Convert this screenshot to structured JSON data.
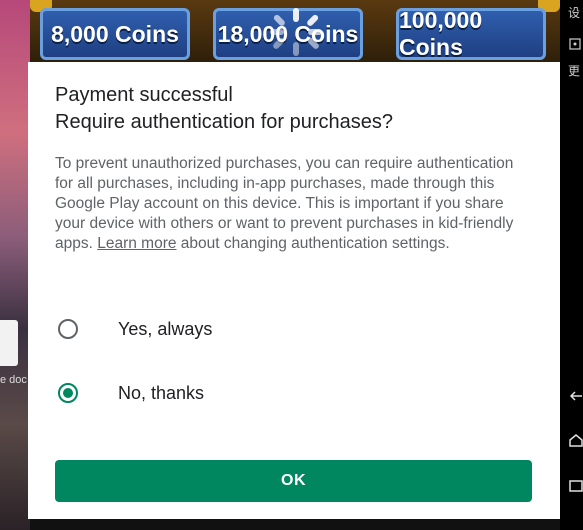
{
  "background": {
    "coin_packs": [
      {
        "label": "8,000 Coins"
      },
      {
        "label": "18,000 Coins"
      },
      {
        "label": "100,000 Coins"
      }
    ],
    "left_thumb_text": "e doc",
    "side_glyphs": [
      "设",
      "更"
    ]
  },
  "dialog": {
    "title_line1": "Payment successful",
    "title_line2": "Require authentication for purchases?",
    "body_before_link": "To prevent unauthorized purchases, you can require authentication for all purchases, including in-app purchases, made through this Google Play account on this device. This is important if you share your device with others or want to prevent purchases in kid-friendly apps. ",
    "body_link": "Learn more",
    "body_after_link": " about changing authentication settings.",
    "options": [
      {
        "label": "Yes, always",
        "selected": false
      },
      {
        "label": "No, thanks",
        "selected": true
      }
    ],
    "ok_label": "OK"
  },
  "colors": {
    "accent": "#01875f",
    "title_text": "#202124",
    "body_text": "#5f6368"
  }
}
